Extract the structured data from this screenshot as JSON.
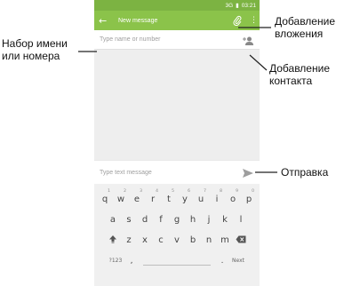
{
  "status_bar": {
    "signal": "3G",
    "time": "03:21"
  },
  "app_bar": {
    "title": "New message"
  },
  "recipient": {
    "placeholder": "Type name or number"
  },
  "compose": {
    "placeholder": "Type text message"
  },
  "keyboard": {
    "row1": [
      "q",
      "w",
      "e",
      "r",
      "t",
      "y",
      "u",
      "i",
      "o",
      "p"
    ],
    "row1_hints": [
      "1",
      "2",
      "3",
      "4",
      "5",
      "6",
      "7",
      "8",
      "9",
      "0"
    ],
    "row2": [
      "a",
      "s",
      "d",
      "f",
      "g",
      "h",
      "j",
      "k",
      "l"
    ],
    "row3": [
      "z",
      "x",
      "c",
      "v",
      "b",
      "n",
      "m"
    ],
    "symbols_key": "?123",
    "comma_key": ",",
    "period_key": ".",
    "next_key": "Next"
  },
  "callouts": {
    "attachment": "Добавление вложения",
    "recipient": "Набор имени или номера",
    "contact": "Добавление контакта",
    "send": "Отправка"
  },
  "colors": {
    "accent": "#8bc34a",
    "status": "#7cb342"
  }
}
